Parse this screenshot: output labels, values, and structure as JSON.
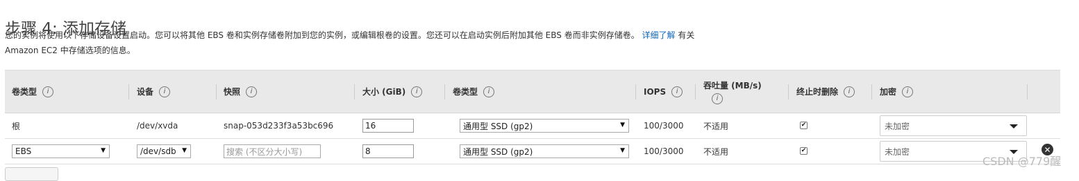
{
  "page": {
    "title": "步骤 4: 添加存储",
    "description_part1": "您的实例将使用以下存储设备设置启动。您可以将其他 EBS 卷和实例存储卷附加到您的实例，或编辑根卷的设置。您还可以在启动实例后附加其他 EBS 卷而非实例存储卷。",
    "learn_more": "详细了解",
    "description_part2": "有关 Amazon EC2 中存储选项的信息。"
  },
  "table": {
    "headers": [
      "卷类型",
      "设备",
      "快照",
      "大小 (GiB)",
      "卷类型",
      "IOPS",
      "吞吐量 (MB/s)",
      "终止时删除",
      "加密"
    ],
    "info_icon_glyph": "i",
    "rows": [
      {
        "volume_type": "根",
        "device": "/dev/xvda",
        "snapshot": "snap-053d233f3a53bc696",
        "size": "16",
        "ebs_volume_type": "通用型 SSD (gp2)",
        "iops": "100/3000",
        "throughput": "不适用",
        "delete_on_termination": true,
        "encryption": "未加密"
      },
      {
        "volume_type": "EBS",
        "device": "/dev/sdb",
        "snapshot_placeholder": "搜索 (不区分大小写)",
        "size": "8",
        "ebs_volume_type": "通用型 SSD (gp2)",
        "iops": "100/3000",
        "throughput": "不适用",
        "delete_on_termination": true,
        "encryption": "未加密"
      }
    ]
  },
  "icons": {
    "select_arrow": "▼",
    "checkmark": "✔",
    "remove": "✕"
  },
  "watermark": "CSDN @779醒",
  "colors": {
    "link": "#1166bb",
    "header_bg": "#e9e9e9"
  }
}
